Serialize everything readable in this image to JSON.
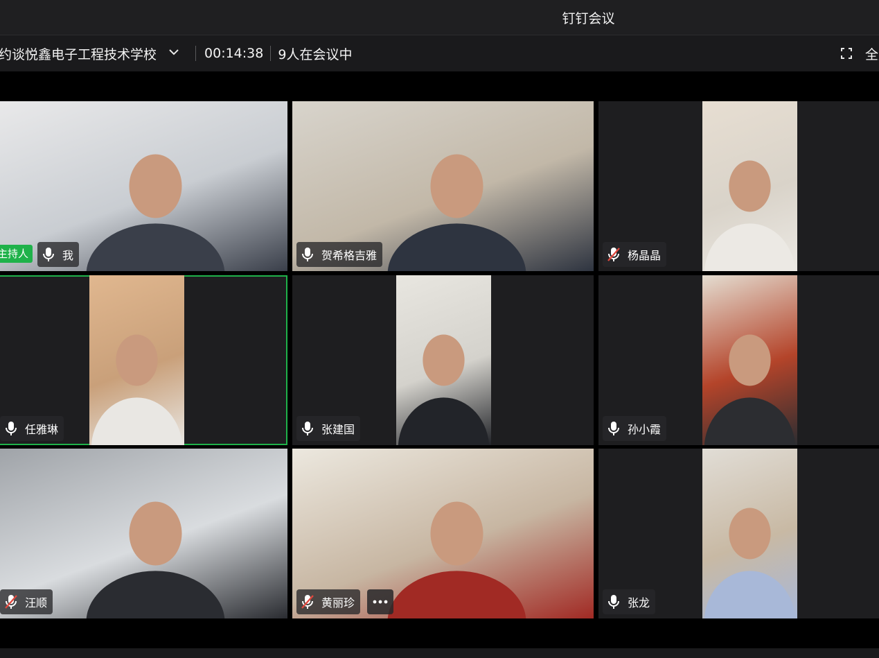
{
  "window": {
    "title": "钉钉会议"
  },
  "meeting": {
    "name": "约谈悦鑫电子工程技术学校",
    "timer": "00:14:38",
    "participant_count": "9人在会议中",
    "fullscreen_label": "全屏"
  },
  "tiles": [
    {
      "name": "我",
      "host_label": "主持人",
      "mic": "on",
      "active": false,
      "more": false,
      "colors": [
        "#e9e9ea",
        "#c9cdd2",
        "#3a3f4a"
      ]
    },
    {
      "name": "贺希格吉雅",
      "mic": "on",
      "active": false,
      "more": false,
      "colors": [
        "#d8d4cc",
        "#c2b8a8",
        "#2e3440"
      ]
    },
    {
      "name": "杨晶晶",
      "mic": "muted",
      "active": false,
      "more": false,
      "colors": [
        "#e7ded2",
        "#d9d3c9",
        "#ece9e4"
      ]
    },
    {
      "name": "任雅琳",
      "mic": "on",
      "active": true,
      "more": false,
      "colors": [
        "#e0b78f",
        "#c9a07a",
        "#e9e7e3"
      ]
    },
    {
      "name": "张建国",
      "mic": "on",
      "active": false,
      "more": false,
      "colors": [
        "#e8e6e0",
        "#d4d2cc",
        "#222429"
      ]
    },
    {
      "name": "孙小霞",
      "mic": "on",
      "active": false,
      "more": false,
      "colors": [
        "#e4ddd1",
        "#b4442a",
        "#2c2d31"
      ]
    },
    {
      "name": "汪顺",
      "mic": "muted",
      "active": false,
      "more": false,
      "colors": [
        "#9fa3a8",
        "#d9dcdf",
        "#2a2c31"
      ]
    },
    {
      "name": "黄丽珍",
      "mic": "muted",
      "active": false,
      "more": true,
      "colors": [
        "#ece8df",
        "#c7b6a2",
        "#a12a24"
      ]
    },
    {
      "name": "张龙",
      "mic": "on",
      "active": false,
      "more": false,
      "colors": [
        "#e1ddd6",
        "#c8b9a4",
        "#a8b8d8"
      ]
    }
  ]
}
